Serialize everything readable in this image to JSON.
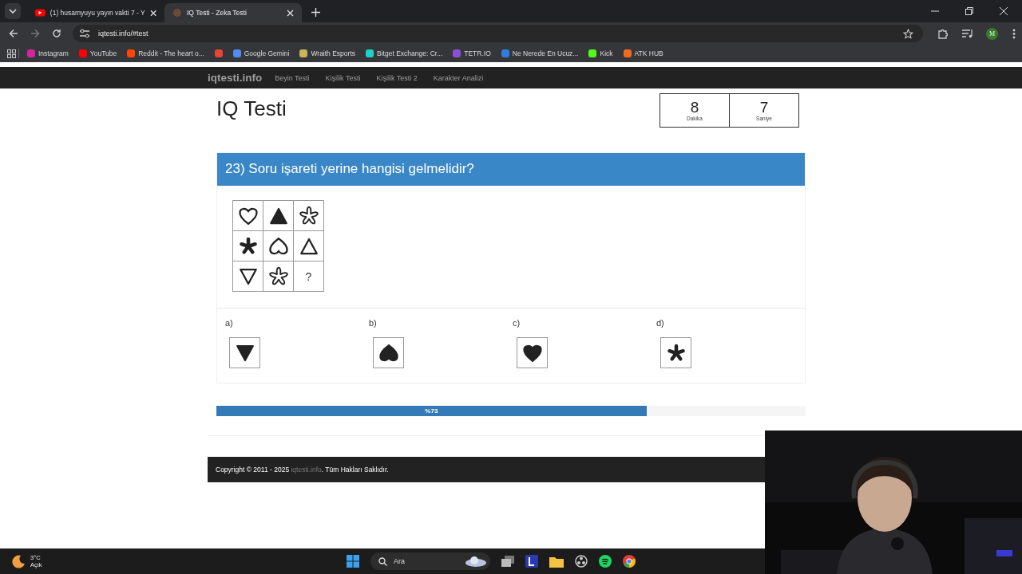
{
  "browser": {
    "tabs": [
      {
        "title": "(1) husamyuyu yayın vakti 7 - Y",
        "selected": false,
        "kind": "video"
      },
      {
        "title": "IQ Testi - Zeka Testi",
        "selected": true,
        "kind": "site"
      }
    ],
    "address": "iqtesti.info/#test",
    "profile_initial": "M",
    "bookmarks": [
      {
        "label": "Instagram",
        "color": "#d6249f"
      },
      {
        "label": "YouTube",
        "color": "#ff0000"
      },
      {
        "label": "Reddit - The heart o...",
        "color": "#ff4500"
      },
      {
        "color": "#ea4335"
      },
      {
        "label": "Google Gemini",
        "color": "#4f8df5"
      },
      {
        "label": "Wraith Esports",
        "color": "#c9b458"
      },
      {
        "label": "Bitget Exchange: Cr...",
        "color": "#1dd3c8"
      },
      {
        "label": "TETR.IO",
        "color": "#8a4fd8"
      },
      {
        "label": "Ne Nerede En Ucuz...",
        "color": "#2f7de1"
      },
      {
        "label": "Kick",
        "color": "#53fc18"
      },
      {
        "label": "ATK HUB",
        "color": "#f26b1d"
      }
    ]
  },
  "site": {
    "brand": "iqtesti.info",
    "nav": [
      "Beyin Testi",
      "Kişilik Testi",
      "Kişilik Testi 2",
      "Karakter Analizi"
    ]
  },
  "title": "IQ Testi",
  "timer": [
    {
      "value": "8",
      "unit": "Dakika"
    },
    {
      "value": "7",
      "unit": "Saniye"
    }
  ],
  "question": "23) Soru işareti yerine hangisi gelmelidir?",
  "grid": [
    {
      "kind": "heart",
      "filled": false,
      "inverted": false
    },
    {
      "kind": "triangle",
      "filled": true,
      "inverted": false
    },
    {
      "kind": "flower",
      "filled": false,
      "inverted": false
    },
    {
      "kind": "asterisk",
      "filled": true,
      "inverted": false
    },
    {
      "kind": "heart",
      "filled": false,
      "inverted": true
    },
    {
      "kind": "triangle",
      "filled": false,
      "inverted": false
    },
    {
      "kind": "triangle",
      "filled": false,
      "inverted": true
    },
    {
      "kind": "flower",
      "filled": false,
      "inverted": false
    },
    {
      "kind": "question",
      "text": "?"
    }
  ],
  "options": [
    {
      "label": "a)",
      "kind": "triangle",
      "filled": true,
      "inverted": true
    },
    {
      "label": "b)",
      "kind": "heart",
      "filled": true,
      "inverted": true
    },
    {
      "label": "c)",
      "kind": "heart",
      "filled": true,
      "inverted": false
    },
    {
      "label": "d)",
      "kind": "asterisk",
      "filled": true,
      "inverted": false
    }
  ],
  "progress": {
    "level": 0.73,
    "label": "%73"
  },
  "footer": {
    "prefix": "Copyright © 2011 - 2025",
    "link": "iqtesti.info",
    "suffix": ". Tüm Hakları Saklıdır."
  },
  "taskbar": {
    "temperature": "3°C",
    "weather": "Açık",
    "search_placeholder": "Ara"
  }
}
